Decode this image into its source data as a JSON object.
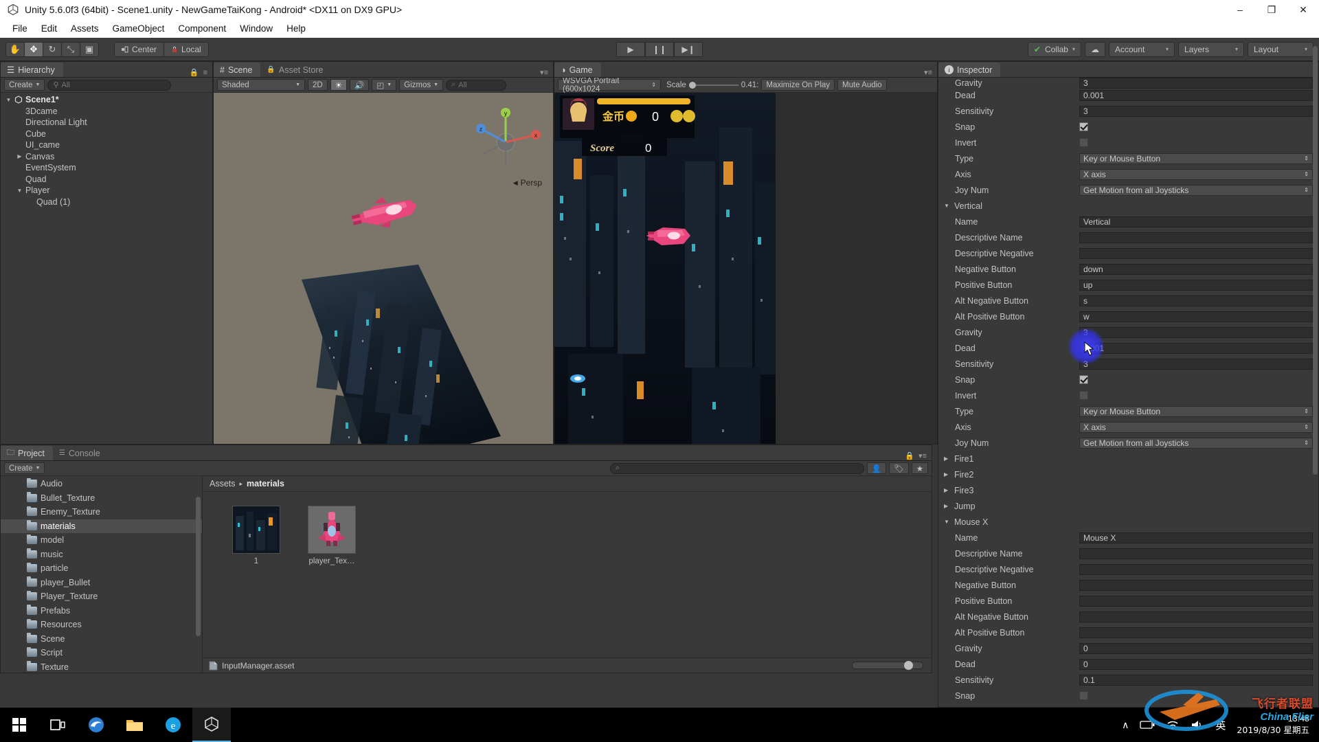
{
  "window": {
    "title": "Unity 5.6.0f3 (64bit) - Scene1.unity - NewGameTaiKong - Android* <DX11 on DX9 GPU>",
    "minimize": "–",
    "maximize": "❐",
    "close": "✕"
  },
  "menubar": {
    "items": [
      "File",
      "Edit",
      "Assets",
      "GameObject",
      "Component",
      "Window",
      "Help"
    ]
  },
  "toolbar": {
    "tools": [
      {
        "name": "hand-tool",
        "glyph": "✋",
        "active": false
      },
      {
        "name": "move-tool",
        "glyph": "✥",
        "active": true
      },
      {
        "name": "rotate-tool",
        "glyph": "↻",
        "active": false
      },
      {
        "name": "scale-tool",
        "glyph": "⤡",
        "active": false
      },
      {
        "name": "rect-tool",
        "glyph": "▣",
        "active": false
      }
    ],
    "pivot_label": "Center",
    "rotation_label": "Local",
    "play": "▶",
    "pause": "❙❙",
    "step": "▶❙",
    "collab": "Collab",
    "collab_check": "✔",
    "cloud": "☁",
    "account": "Account",
    "layers": "Layers",
    "layout": "Layout",
    "caret": "▾"
  },
  "hierarchy": {
    "tab": "Hierarchy",
    "tab_icon": "☰",
    "create": "Create",
    "search_placeholder": "All",
    "search_icon": "⚲",
    "lock_icon": "🔒",
    "menu_icon": "≡",
    "items": [
      {
        "label": "Scene1*",
        "depth": 0,
        "arrow": "▼",
        "root": true
      },
      {
        "label": "3Dcame",
        "depth": 1,
        "arrow": ""
      },
      {
        "label": "Directional Light",
        "depth": 1,
        "arrow": ""
      },
      {
        "label": "Cube",
        "depth": 1,
        "arrow": ""
      },
      {
        "label": "UI_came",
        "depth": 1,
        "arrow": ""
      },
      {
        "label": "Canvas",
        "depth": 1,
        "arrow": "▶"
      },
      {
        "label": "EventSystem",
        "depth": 1,
        "arrow": ""
      },
      {
        "label": "Quad",
        "depth": 1,
        "arrow": ""
      },
      {
        "label": "Player",
        "depth": 1,
        "arrow": "▼"
      },
      {
        "label": "Quad (1)",
        "depth": 2,
        "arrow": ""
      }
    ]
  },
  "scene": {
    "tab": "Scene",
    "tab_icon": "#",
    "assetstore_tab": "Asset Store",
    "assetstore_icon": "🔒",
    "shading": "Shaded",
    "mode_2d": "2D",
    "light_icon": "☀",
    "audio_icon": "🔊",
    "fx_icon": "◰",
    "gizmos": "Gizmos",
    "search_placeholder": "All",
    "persp_label": "Persp",
    "axis_x": "x",
    "axis_y": "y",
    "axis_z": "z"
  },
  "game": {
    "tab": "Game",
    "tab_icon": "◑",
    "aspect": "WSVGA Portrait (600x1024",
    "scale_label": "Scale",
    "scale_value": "0.41:",
    "maximize_on_play": "Maximize On Play",
    "mute_audio": "Mute Audio",
    "hud": {
      "coin_label": "金币",
      "coin_value": "0",
      "score_label": "Score",
      "score_value": "0"
    }
  },
  "project": {
    "tab": "Project",
    "tab_icon": "🗀",
    "console_tab": "Console",
    "console_icon": "☰",
    "create": "Create",
    "search_placeholder": "",
    "folders": [
      {
        "label": "Audio",
        "selected": false
      },
      {
        "label": "Bullet_Texture",
        "selected": false
      },
      {
        "label": "Enemy_Texture",
        "selected": false
      },
      {
        "label": "materials",
        "selected": true
      },
      {
        "label": "model",
        "selected": false
      },
      {
        "label": "music",
        "selected": false
      },
      {
        "label": "particle",
        "selected": false
      },
      {
        "label": "player_Bullet",
        "selected": false
      },
      {
        "label": "Player_Texture",
        "selected": false
      },
      {
        "label": "Prefabs",
        "selected": false
      },
      {
        "label": "Resources",
        "selected": false
      },
      {
        "label": "Scene",
        "selected": false
      },
      {
        "label": "Script",
        "selected": false
      },
      {
        "label": "Texture",
        "selected": false
      }
    ],
    "breadcrumb": {
      "root": "Assets",
      "sep": "▸",
      "current": "materials"
    },
    "assets": [
      {
        "label": "1",
        "kind": "city-texture"
      },
      {
        "label": "player_Tex…",
        "kind": "ship-texture"
      }
    ],
    "status_file": "InputManager.asset",
    "icons": {
      "avatar": "👤",
      "tag": "🏷",
      "star": "★"
    }
  },
  "inspector": {
    "tab": "Inspector",
    "tab_icon": "ℹ",
    "rows": [
      {
        "label": "Gravity",
        "indent": 1,
        "type": "text",
        "value": "3",
        "clipped": true
      },
      {
        "label": "Dead",
        "indent": 1,
        "type": "text",
        "value": "0.001"
      },
      {
        "label": "Sensitivity",
        "indent": 1,
        "type": "text",
        "value": "3"
      },
      {
        "label": "Snap",
        "indent": 1,
        "type": "check",
        "value": true
      },
      {
        "label": "Invert",
        "indent": 1,
        "type": "check",
        "value": false
      },
      {
        "label": "Type",
        "indent": 1,
        "type": "dropdown",
        "value": "Key or Mouse Button"
      },
      {
        "label": "Axis",
        "indent": 1,
        "type": "dropdown",
        "value": "X axis"
      },
      {
        "label": "Joy Num",
        "indent": 1,
        "type": "dropdown",
        "value": "Get Motion from all Joysticks"
      },
      {
        "label": "Vertical",
        "indent": 0,
        "type": "foldout",
        "open": true
      },
      {
        "label": "Name",
        "indent": 1,
        "type": "text",
        "value": "Vertical"
      },
      {
        "label": "Descriptive Name",
        "indent": 1,
        "type": "text",
        "value": ""
      },
      {
        "label": "Descriptive Negative",
        "indent": 1,
        "type": "text",
        "value": ""
      },
      {
        "label": "Negative Button",
        "indent": 1,
        "type": "text",
        "value": "down"
      },
      {
        "label": "Positive Button",
        "indent": 1,
        "type": "text",
        "value": "up"
      },
      {
        "label": "Alt Negative Button",
        "indent": 1,
        "type": "text",
        "value": "s"
      },
      {
        "label": "Alt Positive Button",
        "indent": 1,
        "type": "text",
        "value": "w"
      },
      {
        "label": "Gravity",
        "indent": 1,
        "type": "text",
        "value": "3"
      },
      {
        "label": "Dead",
        "indent": 1,
        "type": "text",
        "value": "0.001"
      },
      {
        "label": "Sensitivity",
        "indent": 1,
        "type": "text",
        "value": "3"
      },
      {
        "label": "Snap",
        "indent": 1,
        "type": "check",
        "value": true
      },
      {
        "label": "Invert",
        "indent": 1,
        "type": "check",
        "value": false
      },
      {
        "label": "Type",
        "indent": 1,
        "type": "dropdown",
        "value": "Key or Mouse Button"
      },
      {
        "label": "Axis",
        "indent": 1,
        "type": "dropdown",
        "value": "X axis"
      },
      {
        "label": "Joy Num",
        "indent": 1,
        "type": "dropdown",
        "value": "Get Motion from all Joysticks"
      },
      {
        "label": "Fire1",
        "indent": 0,
        "type": "foldout",
        "open": false
      },
      {
        "label": "Fire2",
        "indent": 0,
        "type": "foldout",
        "open": false
      },
      {
        "label": "Fire3",
        "indent": 0,
        "type": "foldout",
        "open": false
      },
      {
        "label": "Jump",
        "indent": 0,
        "type": "foldout",
        "open": false
      },
      {
        "label": "Mouse X",
        "indent": 0,
        "type": "foldout",
        "open": true
      },
      {
        "label": "Name",
        "indent": 1,
        "type": "text",
        "value": "Mouse X"
      },
      {
        "label": "Descriptive Name",
        "indent": 1,
        "type": "text",
        "value": ""
      },
      {
        "label": "Descriptive Negative",
        "indent": 1,
        "type": "text",
        "value": ""
      },
      {
        "label": "Negative Button",
        "indent": 1,
        "type": "text",
        "value": ""
      },
      {
        "label": "Positive Button",
        "indent": 1,
        "type": "text",
        "value": ""
      },
      {
        "label": "Alt Negative Button",
        "indent": 1,
        "type": "text",
        "value": ""
      },
      {
        "label": "Alt Positive Button",
        "indent": 1,
        "type": "text",
        "value": ""
      },
      {
        "label": "Gravity",
        "indent": 1,
        "type": "text",
        "value": "0"
      },
      {
        "label": "Dead",
        "indent": 1,
        "type": "text",
        "value": "0"
      },
      {
        "label": "Sensitivity",
        "indent": 1,
        "type": "text",
        "value": "0.1"
      },
      {
        "label": "Snap",
        "indent": 1,
        "type": "check",
        "value": false
      }
    ]
  },
  "taskbar": {
    "start_icon": "⊞",
    "taskview_icon": "❐",
    "apps": [
      {
        "name": "edge",
        "glyph": "e"
      },
      {
        "name": "explorer",
        "glyph": "📁"
      },
      {
        "name": "ie",
        "glyph": "e"
      },
      {
        "name": "unity",
        "glyph": "◇",
        "active": true
      }
    ],
    "tray": {
      "chevron": "∧",
      "battery": "🔋",
      "wifi": "📶",
      "volume": "🔊",
      "ime": "英"
    },
    "time": "13:48",
    "date": "2019/8/30 星期五"
  },
  "watermark": {
    "cn": "飞行者联盟",
    "en": "China Flier"
  },
  "colors": {
    "panel_bg": "#383838",
    "panel_alt": "#393939",
    "accent_blue": "#3c3cff",
    "scene_bg": "#7b7669"
  }
}
